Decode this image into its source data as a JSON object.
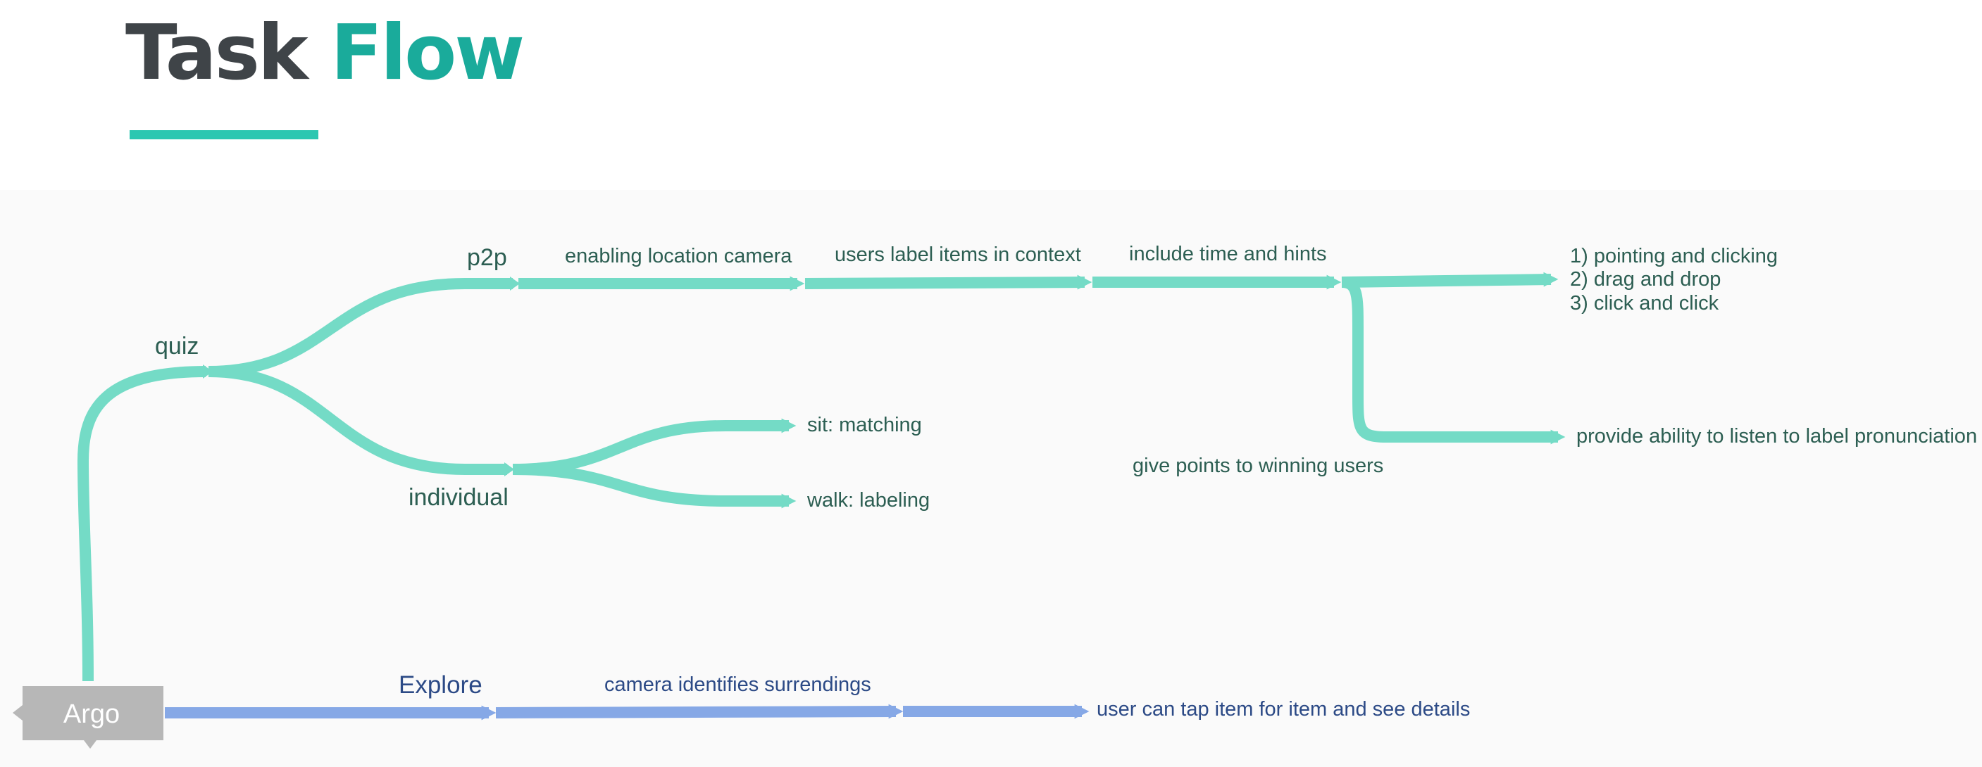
{
  "title": {
    "word1": "Task",
    "word2": "Flow"
  },
  "colors": {
    "teal": "#74dbc6",
    "blue": "#86a8e6",
    "title_dark": "#3f4448",
    "title_accent": "#1aab9b",
    "underline": "#2cc7b1",
    "label_teal": "#2c5e52",
    "label_blue": "#2c4a86",
    "root_box": "#b7b7b7"
  },
  "root": {
    "label": "Argo"
  },
  "teal_labels": {
    "quiz": "quiz",
    "p2p": "p2p",
    "individual": "individual",
    "enabling": "enabling location camera",
    "users_label": "users label items in context",
    "time_hints": "include time and hints",
    "opt1": "1) pointing and clicking",
    "opt2": "2) drag and drop",
    "opt3": "3) click and click",
    "listen": "provide ability to listen to label pronunciation",
    "points": "give points to winning users",
    "sit": "sit: matching",
    "walk": "walk: labeling"
  },
  "blue_labels": {
    "explore": "Explore",
    "camera": "camera identifies surrendings",
    "tap": "user can tap item for item and see details"
  }
}
